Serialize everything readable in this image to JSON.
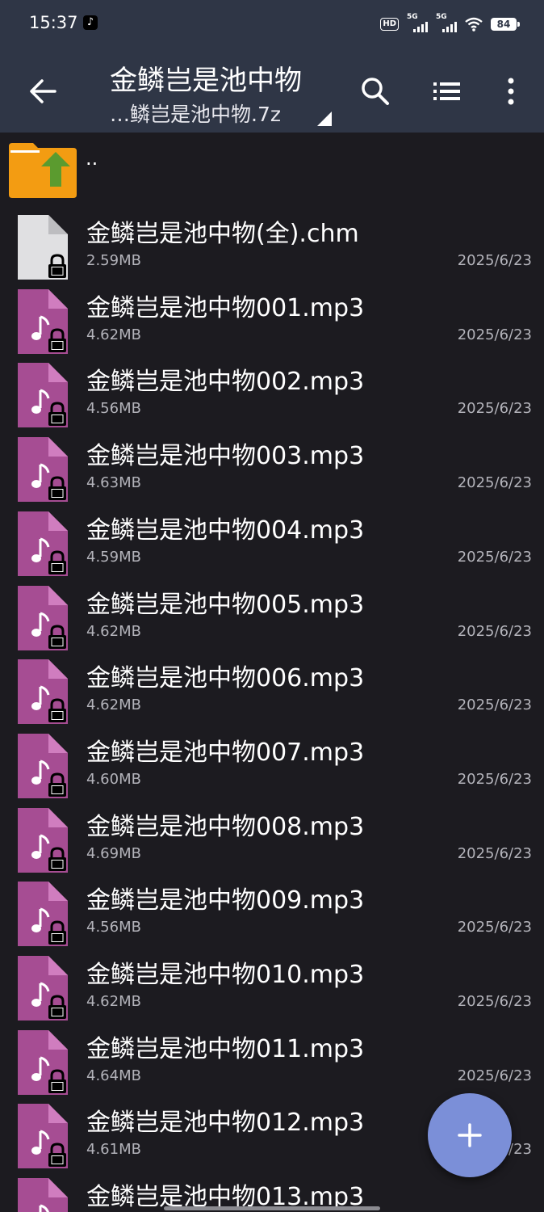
{
  "status_bar": {
    "time": "15:37",
    "hd_label": "HD",
    "signal1_label": "5G",
    "signal2_label": "5G",
    "battery": "84",
    "notification_icon": "tiktok-icon"
  },
  "header": {
    "title": "金鳞岂是池中物",
    "subtitle": "…鳞岂是池中物.7z",
    "back_icon": "back-arrow-icon",
    "search_icon": "search-icon",
    "list_icon": "list-view-icon",
    "more_icon": "more-vertical-icon"
  },
  "parent_dir": {
    "label": ".."
  },
  "files": [
    {
      "name": "金鳞岂是池中物(全).chm",
      "size": "2.59MB",
      "date": "2025/6/23",
      "type": "doc"
    },
    {
      "name": "金鳞岂是池中物001.mp3",
      "size": "4.62MB",
      "date": "2025/6/23",
      "type": "audio"
    },
    {
      "name": "金鳞岂是池中物002.mp3",
      "size": "4.56MB",
      "date": "2025/6/23",
      "type": "audio"
    },
    {
      "name": "金鳞岂是池中物003.mp3",
      "size": "4.63MB",
      "date": "2025/6/23",
      "type": "audio"
    },
    {
      "name": "金鳞岂是池中物004.mp3",
      "size": "4.59MB",
      "date": "2025/6/23",
      "type": "audio"
    },
    {
      "name": "金鳞岂是池中物005.mp3",
      "size": "4.62MB",
      "date": "2025/6/23",
      "type": "audio"
    },
    {
      "name": "金鳞岂是池中物006.mp3",
      "size": "4.62MB",
      "date": "2025/6/23",
      "type": "audio"
    },
    {
      "name": "金鳞岂是池中物007.mp3",
      "size": "4.60MB",
      "date": "2025/6/23",
      "type": "audio"
    },
    {
      "name": "金鳞岂是池中物008.mp3",
      "size": "4.69MB",
      "date": "2025/6/23",
      "type": "audio"
    },
    {
      "name": "金鳞岂是池中物009.mp3",
      "size": "4.56MB",
      "date": "2025/6/23",
      "type": "audio"
    },
    {
      "name": "金鳞岂是池中物010.mp3",
      "size": "4.62MB",
      "date": "2025/6/23",
      "type": "audio"
    },
    {
      "name": "金鳞岂是池中物011.mp3",
      "size": "4.64MB",
      "date": "2025/6/23",
      "type": "audio"
    },
    {
      "name": "金鳞岂是池中物012.mp3",
      "size": "4.61MB",
      "date": "2025/6/23",
      "type": "audio"
    },
    {
      "name": "金鳞岂是池中物013.mp3",
      "size": "",
      "date": "",
      "type": "audio"
    }
  ],
  "fab": {
    "icon": "plus-icon"
  },
  "colors": {
    "header_bg": "#2f3646",
    "list_bg": "#1c1b20",
    "audio_icon": "#a64d93",
    "doc_icon": "#e0e0e2",
    "folder": "#f39c12",
    "fab": "#7b8fd8"
  }
}
